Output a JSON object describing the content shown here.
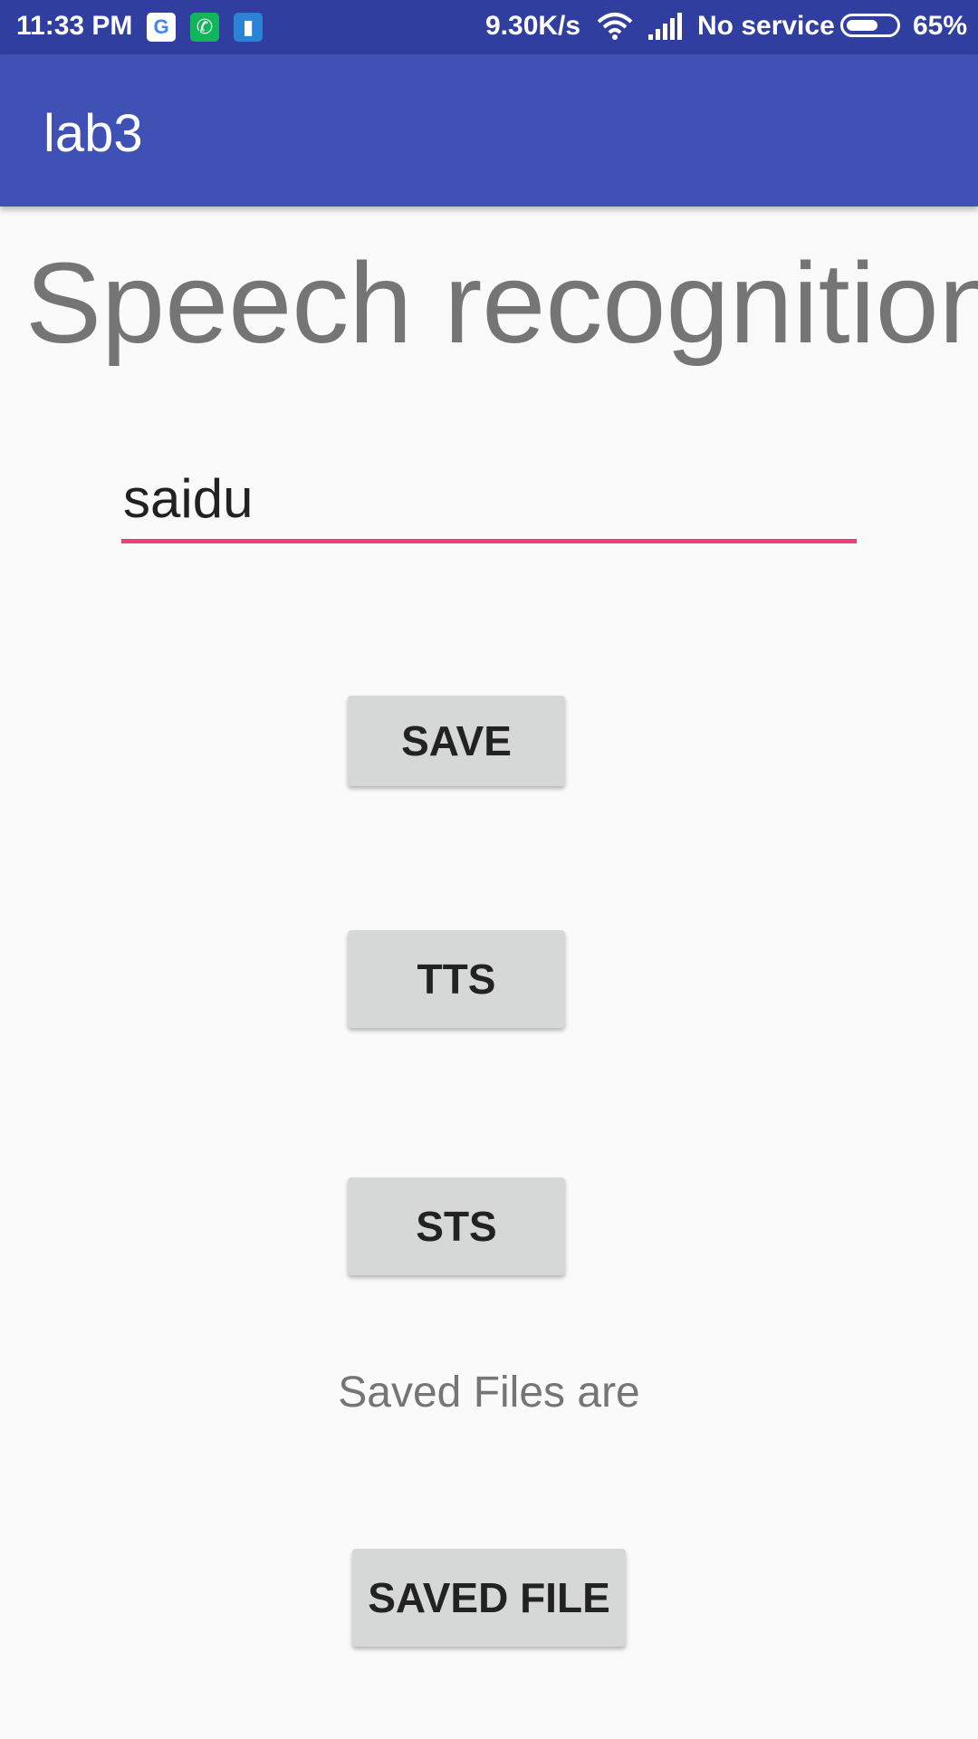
{
  "status_bar": {
    "time": "11:33 PM",
    "notification_icons": [
      "google-icon",
      "phone-call-icon",
      "document-icon"
    ],
    "network_speed": "9.30K/s",
    "network_status": "No service",
    "battery_percent": "65%",
    "battery_level": 0.65
  },
  "app_bar": {
    "title": "lab3"
  },
  "main": {
    "heading": "Speech recognition",
    "input": {
      "value": "saidu",
      "underline_color": "#ec407a"
    },
    "buttons": {
      "save_label": "SAVE",
      "tts_label": "TTS",
      "sts_label": "STS",
      "saved_file_label": "SAVED FILE"
    },
    "saved_files_text": "Saved Files are"
  },
  "colors": {
    "status_bar": "#303f9f",
    "app_bar": "#3f51b5",
    "accent": "#ec407a",
    "button": "#d6d7d7",
    "background": "#fafafa"
  }
}
